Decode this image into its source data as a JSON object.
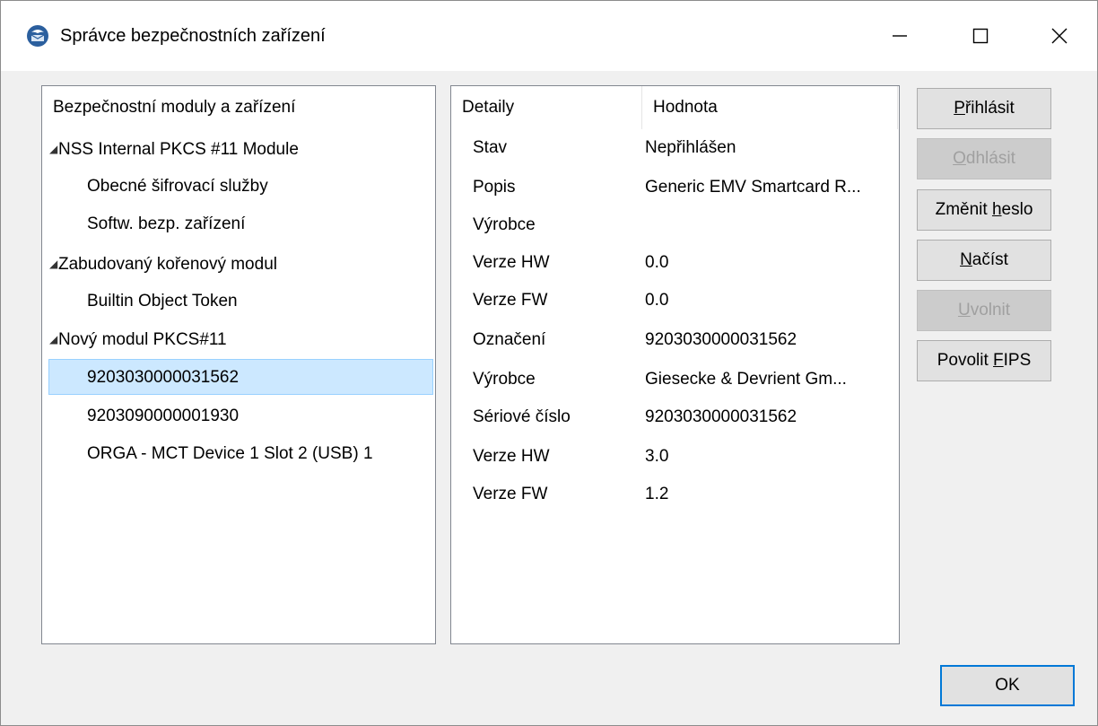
{
  "window": {
    "title": "Správce bezpečnostních zařízení"
  },
  "tree": {
    "header": "Bezpečnostní moduly a zařízení",
    "items": [
      {
        "label": "NSS Internal PKCS #11 Module",
        "level": 0,
        "expanded": true
      },
      {
        "label": "Obecné šifrovací služby",
        "level": 1
      },
      {
        "label": "Softw. bezp. zařízení",
        "level": 1
      },
      {
        "label": "Zabudovaný kořenový modul",
        "level": 0,
        "expanded": true
      },
      {
        "label": "Builtin Object Token",
        "level": 1
      },
      {
        "label": "Nový modul PKCS#11",
        "level": 0,
        "expanded": true
      },
      {
        "label": "9203030000031562",
        "level": 1,
        "selected": true
      },
      {
        "label": "9203090000001930",
        "level": 1
      },
      {
        "label": "ORGA - MCT Device 1 Slot 2 (USB) 1",
        "level": 1
      }
    ]
  },
  "details": {
    "columns": [
      "Detaily",
      "Hodnota"
    ],
    "rows": [
      {
        "key": "Stav",
        "value": "Nepřihlášen"
      },
      {
        "key": "Popis",
        "value": "Generic EMV Smartcard R..."
      },
      {
        "key": "Výrobce",
        "value": ""
      },
      {
        "key": "Verze HW",
        "value": "0.0"
      },
      {
        "key": "Verze FW",
        "value": "0.0"
      },
      {
        "key": "Označení",
        "value": "9203030000031562"
      },
      {
        "key": "Výrobce",
        "value": "Giesecke & Devrient Gm..."
      },
      {
        "key": "Sériové číslo",
        "value": "9203030000031562"
      },
      {
        "key": "Verze HW",
        "value": "3.0"
      },
      {
        "key": "Verze FW",
        "value": "1.2"
      }
    ]
  },
  "buttons": {
    "login": {
      "pre": "",
      "u": "P",
      "post": "řihlásit",
      "enabled": true
    },
    "logout": {
      "pre": "",
      "u": "O",
      "post": "dhlásit",
      "enabled": false
    },
    "change_password": {
      "pre": "Změnit ",
      "u": "h",
      "post": "eslo",
      "enabled": true
    },
    "load": {
      "pre": "",
      "u": "N",
      "post": "ačíst",
      "enabled": true
    },
    "unload": {
      "pre": "",
      "u": "U",
      "post": "volnit",
      "enabled": false
    },
    "enable_fips": {
      "pre": "Povolit ",
      "u": "F",
      "post": "IPS",
      "enabled": true
    },
    "ok": "OK"
  },
  "colors": {
    "selection_bg": "#cce8ff",
    "selection_border": "#99d1ff",
    "default_button_border": "#0078d7"
  },
  "icons": {
    "app": "thunderbird-icon",
    "minimize": "minimize-icon",
    "maximize": "maximize-icon",
    "close": "close-icon",
    "expand": "expanded-triangle-icon"
  }
}
